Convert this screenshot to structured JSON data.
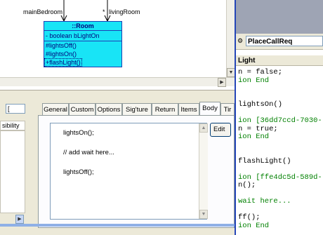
{
  "diagram": {
    "assoc_left": "mainBedroom",
    "assoc_right_mult": "*",
    "assoc_right": "livingRoom",
    "class_name": "::Room",
    "attributes": [
      "- boolean bLightOn"
    ],
    "operations": [
      "#lightsOff()",
      "#lightsOn()",
      "+flashLight()"
    ]
  },
  "code_pane": {
    "name_value": "PlaceCallReq",
    "header": "Light",
    "lines": [
      {
        "text": "n = false;",
        "color": "#000000"
      },
      {
        "text": "ion End",
        "color": "#008000"
      },
      {
        "text": "",
        "color": "#000000"
      },
      {
        "text": "",
        "color": "#000000"
      },
      {
        "text": "lightsOn()",
        "color": "#000000"
      },
      {
        "text": "",
        "color": "#000000"
      },
      {
        "text": "ion [36dd7ccd-7030-",
        "color": "#008000"
      },
      {
        "text": "n = true;",
        "color": "#000000"
      },
      {
        "text": "ion End",
        "color": "#008000"
      },
      {
        "text": "",
        "color": "#000000"
      },
      {
        "text": "",
        "color": "#000000"
      },
      {
        "text": "flashLight()",
        "color": "#000000"
      },
      {
        "text": "",
        "color": "#000000"
      },
      {
        "text": "ion [ffe4dc5d-589d-",
        "color": "#008000"
      },
      {
        "text": "n();",
        "color": "#000000"
      },
      {
        "text": "",
        "color": "#000000"
      },
      {
        "text": "wait here...",
        "color": "#008000"
      },
      {
        "text": "",
        "color": "#000000"
      },
      {
        "text": "ff();",
        "color": "#000000"
      },
      {
        "text": "ion End",
        "color": "#008000"
      }
    ]
  },
  "left_panel": {
    "field_top": "[",
    "field_label": "sibility"
  },
  "tabs": [
    "General",
    "Custom",
    "Options",
    "Sig'ture",
    "Return",
    "Items",
    "Body",
    "Tir"
  ],
  "active_tab": "Body",
  "body_editor": {
    "lines": [
      "lightsOn();",
      "",
      "// add wait here...",
      "",
      "lightsOff();"
    ]
  },
  "edit_button": "Edit"
}
